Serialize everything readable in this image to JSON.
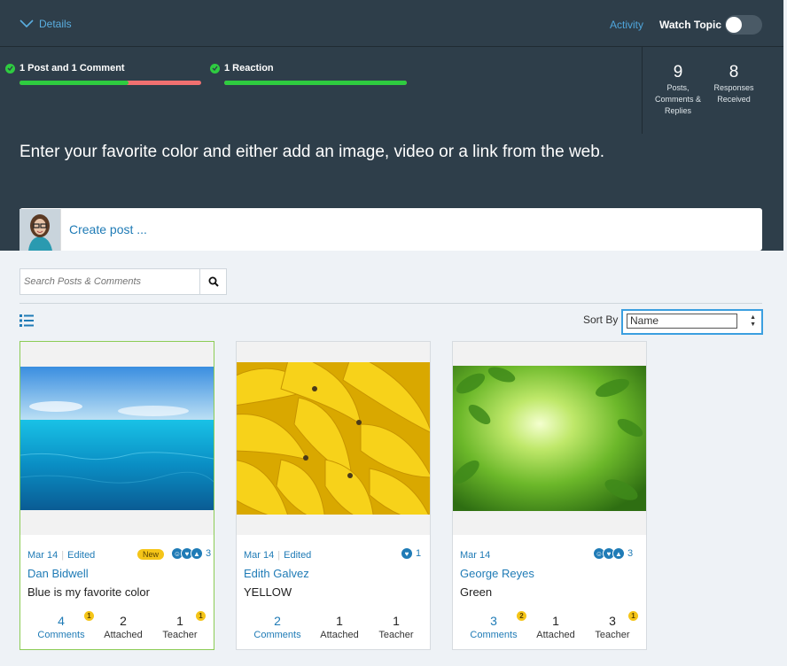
{
  "header": {
    "details_label": "Details",
    "activity_label": "Activity",
    "watch_label": "Watch Topic"
  },
  "progress": [
    {
      "label": "1 Post and 1 Comment",
      "complete_fraction": 0.6
    },
    {
      "label": "1 Reaction",
      "complete_fraction": 1.0
    }
  ],
  "stats": [
    {
      "value": "9",
      "label_lines": [
        "Posts,",
        "Comments &",
        "Replies"
      ]
    },
    {
      "value": "8",
      "label_lines": [
        "Responses",
        "Received"
      ]
    }
  ],
  "prompt": "Enter your favorite color and either add an image, video or a link from the web.",
  "create_post_placeholder": "Create post ...",
  "search": {
    "placeholder": "Search Posts & Comments"
  },
  "sort": {
    "label": "Sort By",
    "value": "Name"
  },
  "colors": {
    "accent": "#1f7bb6",
    "header_bg": "#2e3e4a",
    "success": "#2ecc40",
    "warning_bar": "#f07070",
    "badge": "#f5c518"
  },
  "cards": [
    {
      "date": "Mar 14",
      "edited": "Edited",
      "new_badge": "New",
      "author": "Dan Bidwell",
      "body": "Blue is my favorite color",
      "reaction_count": "3",
      "counts": {
        "comments": "4",
        "comments_label": "Comments",
        "comments_badge": "1",
        "attached": "2",
        "attached_label": "Attached",
        "teacher": "1",
        "teacher_label": "Teacher",
        "teacher_badge": "1"
      }
    },
    {
      "date": "Mar 14",
      "edited": "Edited",
      "author": "Edith Galvez",
      "body": "YELLOW",
      "reaction_count": "1",
      "counts": {
        "comments": "2",
        "comments_label": "Comments",
        "attached": "1",
        "attached_label": "Attached",
        "teacher": "1",
        "teacher_label": "Teacher"
      }
    },
    {
      "date": "Mar 14",
      "author": "George Reyes",
      "body": "Green",
      "reaction_count": "3",
      "counts": {
        "comments": "3",
        "comments_label": "Comments",
        "comments_badge": "2",
        "attached": "1",
        "attached_label": "Attached",
        "teacher": "3",
        "teacher_label": "Teacher",
        "teacher_badge": "1"
      }
    }
  ]
}
